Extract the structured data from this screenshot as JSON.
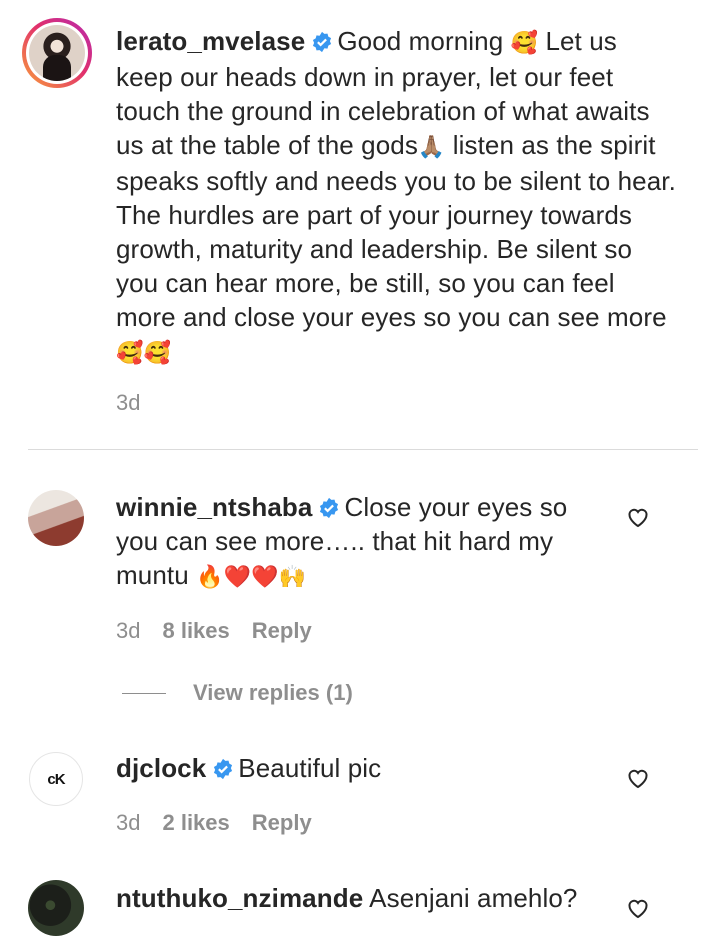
{
  "caption": {
    "username": "lerato_mvelase",
    "text_1": "Good morning",
    "emoji_1": "🥰",
    "text_2": "Let us keep our heads down in prayer, let our feet touch the ground in celebration of what awaits us at the table of the gods",
    "emoji_2": "🙏🏽",
    "text_3": "listen as the spirit speaks softly and needs you to be silent to hear. The hurdles are part of your journey towards growth, maturity and leadership. Be silent so you can hear more, be still, so you can feel more and close your eyes so you can see more",
    "emoji_3": "🥰🥰",
    "time": "3d"
  },
  "comments": [
    {
      "username": "winnie_ntshaba",
      "text": "Close your eyes so you can see more….. that hit hard my muntu",
      "emoji": "🔥❤️❤️🙌",
      "time": "3d",
      "likes": "8 likes",
      "reply": "Reply",
      "view_replies": "View replies (1)"
    },
    {
      "username": "djclock",
      "avatar_text": "cK",
      "text": "Beautiful pic",
      "time": "3d",
      "likes": "2 likes",
      "reply": "Reply"
    },
    {
      "username": "ntuthuko_nzimande",
      "text": "Asenjani amehlo?"
    }
  ],
  "colors": {
    "verified": "#3897f0",
    "muted": "#8e8e8e",
    "text": "#262626"
  }
}
